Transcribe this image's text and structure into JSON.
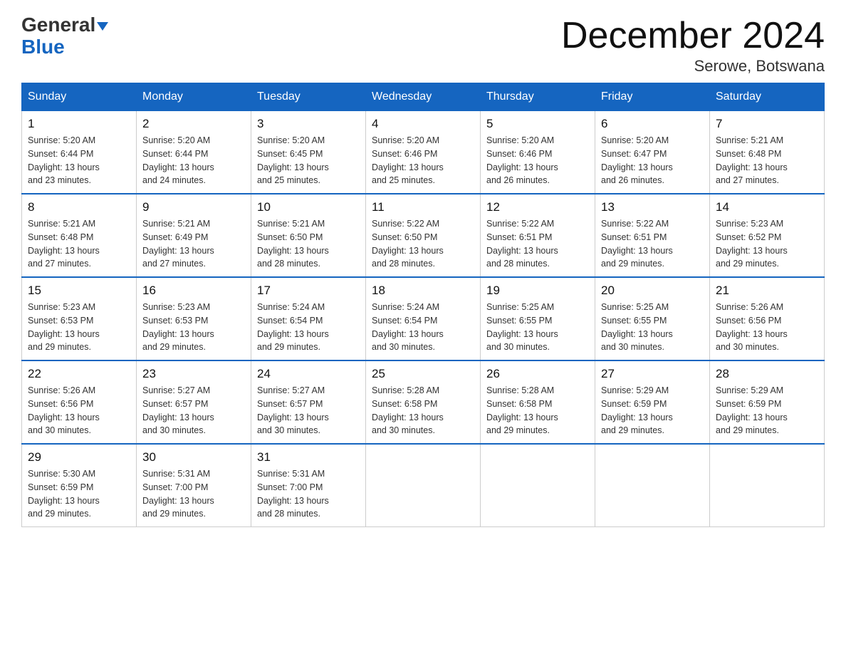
{
  "header": {
    "logo_general": "General",
    "logo_blue": "Blue",
    "title": "December 2024",
    "subtitle": "Serowe, Botswana"
  },
  "days_of_week": [
    "Sunday",
    "Monday",
    "Tuesday",
    "Wednesday",
    "Thursday",
    "Friday",
    "Saturday"
  ],
  "weeks": [
    [
      {
        "day": "1",
        "sunrise": "5:20 AM",
        "sunset": "6:44 PM",
        "daylight": "13 hours and 23 minutes."
      },
      {
        "day": "2",
        "sunrise": "5:20 AM",
        "sunset": "6:44 PM",
        "daylight": "13 hours and 24 minutes."
      },
      {
        "day": "3",
        "sunrise": "5:20 AM",
        "sunset": "6:45 PM",
        "daylight": "13 hours and 25 minutes."
      },
      {
        "day": "4",
        "sunrise": "5:20 AM",
        "sunset": "6:46 PM",
        "daylight": "13 hours and 25 minutes."
      },
      {
        "day": "5",
        "sunrise": "5:20 AM",
        "sunset": "6:46 PM",
        "daylight": "13 hours and 26 minutes."
      },
      {
        "day": "6",
        "sunrise": "5:20 AM",
        "sunset": "6:47 PM",
        "daylight": "13 hours and 26 minutes."
      },
      {
        "day": "7",
        "sunrise": "5:21 AM",
        "sunset": "6:48 PM",
        "daylight": "13 hours and 27 minutes."
      }
    ],
    [
      {
        "day": "8",
        "sunrise": "5:21 AM",
        "sunset": "6:48 PM",
        "daylight": "13 hours and 27 minutes."
      },
      {
        "day": "9",
        "sunrise": "5:21 AM",
        "sunset": "6:49 PM",
        "daylight": "13 hours and 27 minutes."
      },
      {
        "day": "10",
        "sunrise": "5:21 AM",
        "sunset": "6:50 PM",
        "daylight": "13 hours and 28 minutes."
      },
      {
        "day": "11",
        "sunrise": "5:22 AM",
        "sunset": "6:50 PM",
        "daylight": "13 hours and 28 minutes."
      },
      {
        "day": "12",
        "sunrise": "5:22 AM",
        "sunset": "6:51 PM",
        "daylight": "13 hours and 28 minutes."
      },
      {
        "day": "13",
        "sunrise": "5:22 AM",
        "sunset": "6:51 PM",
        "daylight": "13 hours and 29 minutes."
      },
      {
        "day": "14",
        "sunrise": "5:23 AM",
        "sunset": "6:52 PM",
        "daylight": "13 hours and 29 minutes."
      }
    ],
    [
      {
        "day": "15",
        "sunrise": "5:23 AM",
        "sunset": "6:53 PM",
        "daylight": "13 hours and 29 minutes."
      },
      {
        "day": "16",
        "sunrise": "5:23 AM",
        "sunset": "6:53 PM",
        "daylight": "13 hours and 29 minutes."
      },
      {
        "day": "17",
        "sunrise": "5:24 AM",
        "sunset": "6:54 PM",
        "daylight": "13 hours and 29 minutes."
      },
      {
        "day": "18",
        "sunrise": "5:24 AM",
        "sunset": "6:54 PM",
        "daylight": "13 hours and 30 minutes."
      },
      {
        "day": "19",
        "sunrise": "5:25 AM",
        "sunset": "6:55 PM",
        "daylight": "13 hours and 30 minutes."
      },
      {
        "day": "20",
        "sunrise": "5:25 AM",
        "sunset": "6:55 PM",
        "daylight": "13 hours and 30 minutes."
      },
      {
        "day": "21",
        "sunrise": "5:26 AM",
        "sunset": "6:56 PM",
        "daylight": "13 hours and 30 minutes."
      }
    ],
    [
      {
        "day": "22",
        "sunrise": "5:26 AM",
        "sunset": "6:56 PM",
        "daylight": "13 hours and 30 minutes."
      },
      {
        "day": "23",
        "sunrise": "5:27 AM",
        "sunset": "6:57 PM",
        "daylight": "13 hours and 30 minutes."
      },
      {
        "day": "24",
        "sunrise": "5:27 AM",
        "sunset": "6:57 PM",
        "daylight": "13 hours and 30 minutes."
      },
      {
        "day": "25",
        "sunrise": "5:28 AM",
        "sunset": "6:58 PM",
        "daylight": "13 hours and 30 minutes."
      },
      {
        "day": "26",
        "sunrise": "5:28 AM",
        "sunset": "6:58 PM",
        "daylight": "13 hours and 29 minutes."
      },
      {
        "day": "27",
        "sunrise": "5:29 AM",
        "sunset": "6:59 PM",
        "daylight": "13 hours and 29 minutes."
      },
      {
        "day": "28",
        "sunrise": "5:29 AM",
        "sunset": "6:59 PM",
        "daylight": "13 hours and 29 minutes."
      }
    ],
    [
      {
        "day": "29",
        "sunrise": "5:30 AM",
        "sunset": "6:59 PM",
        "daylight": "13 hours and 29 minutes."
      },
      {
        "day": "30",
        "sunrise": "5:31 AM",
        "sunset": "7:00 PM",
        "daylight": "13 hours and 29 minutes."
      },
      {
        "day": "31",
        "sunrise": "5:31 AM",
        "sunset": "7:00 PM",
        "daylight": "13 hours and 28 minutes."
      },
      null,
      null,
      null,
      null
    ]
  ],
  "labels": {
    "sunrise": "Sunrise:",
    "sunset": "Sunset:",
    "daylight": "Daylight:"
  }
}
